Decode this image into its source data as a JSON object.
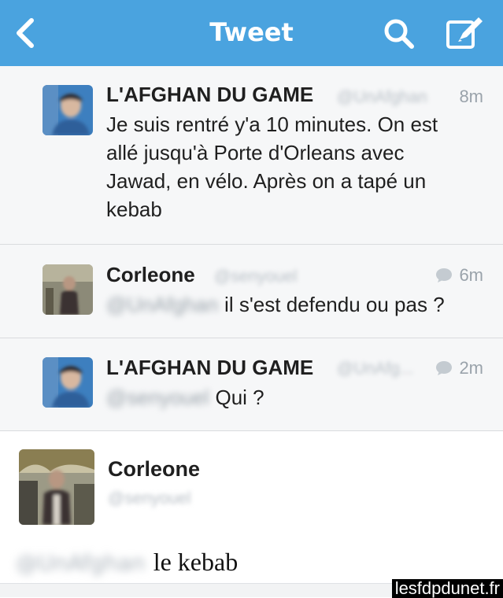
{
  "nav": {
    "title": "Tweet",
    "icons": [
      "back-chevron-icon",
      "search-icon",
      "compose-icon"
    ],
    "background": "#4aa3df"
  },
  "tweets": [
    {
      "name": "L'AFGHAN DU GAME",
      "handle": "@UnAfghan",
      "time": "8m",
      "text_lines": [
        "Je suis rentré y'a 10 minutes. On est",
        "allé jusqu'à Porte d'Orleans avec",
        "Jawad, en vélo. Après on a tapé un",
        "kebab"
      ]
    },
    {
      "name": "Corleone",
      "handle": "@senyouel",
      "time": "6m",
      "mention": "@UnAfghan",
      "text": "il s'est defendu ou pas ?"
    },
    {
      "name": "L'AFGHAN DU GAME",
      "handle": "@UnAfg...",
      "time": "2m",
      "mention": "@senyouel",
      "text": "Qui ?"
    }
  ],
  "detail": {
    "name": "Corleone",
    "handle": "@senyouel",
    "mention": "@UnAfghan",
    "text": "le kebab"
  },
  "watermark": "lesfdpdunet.fr"
}
